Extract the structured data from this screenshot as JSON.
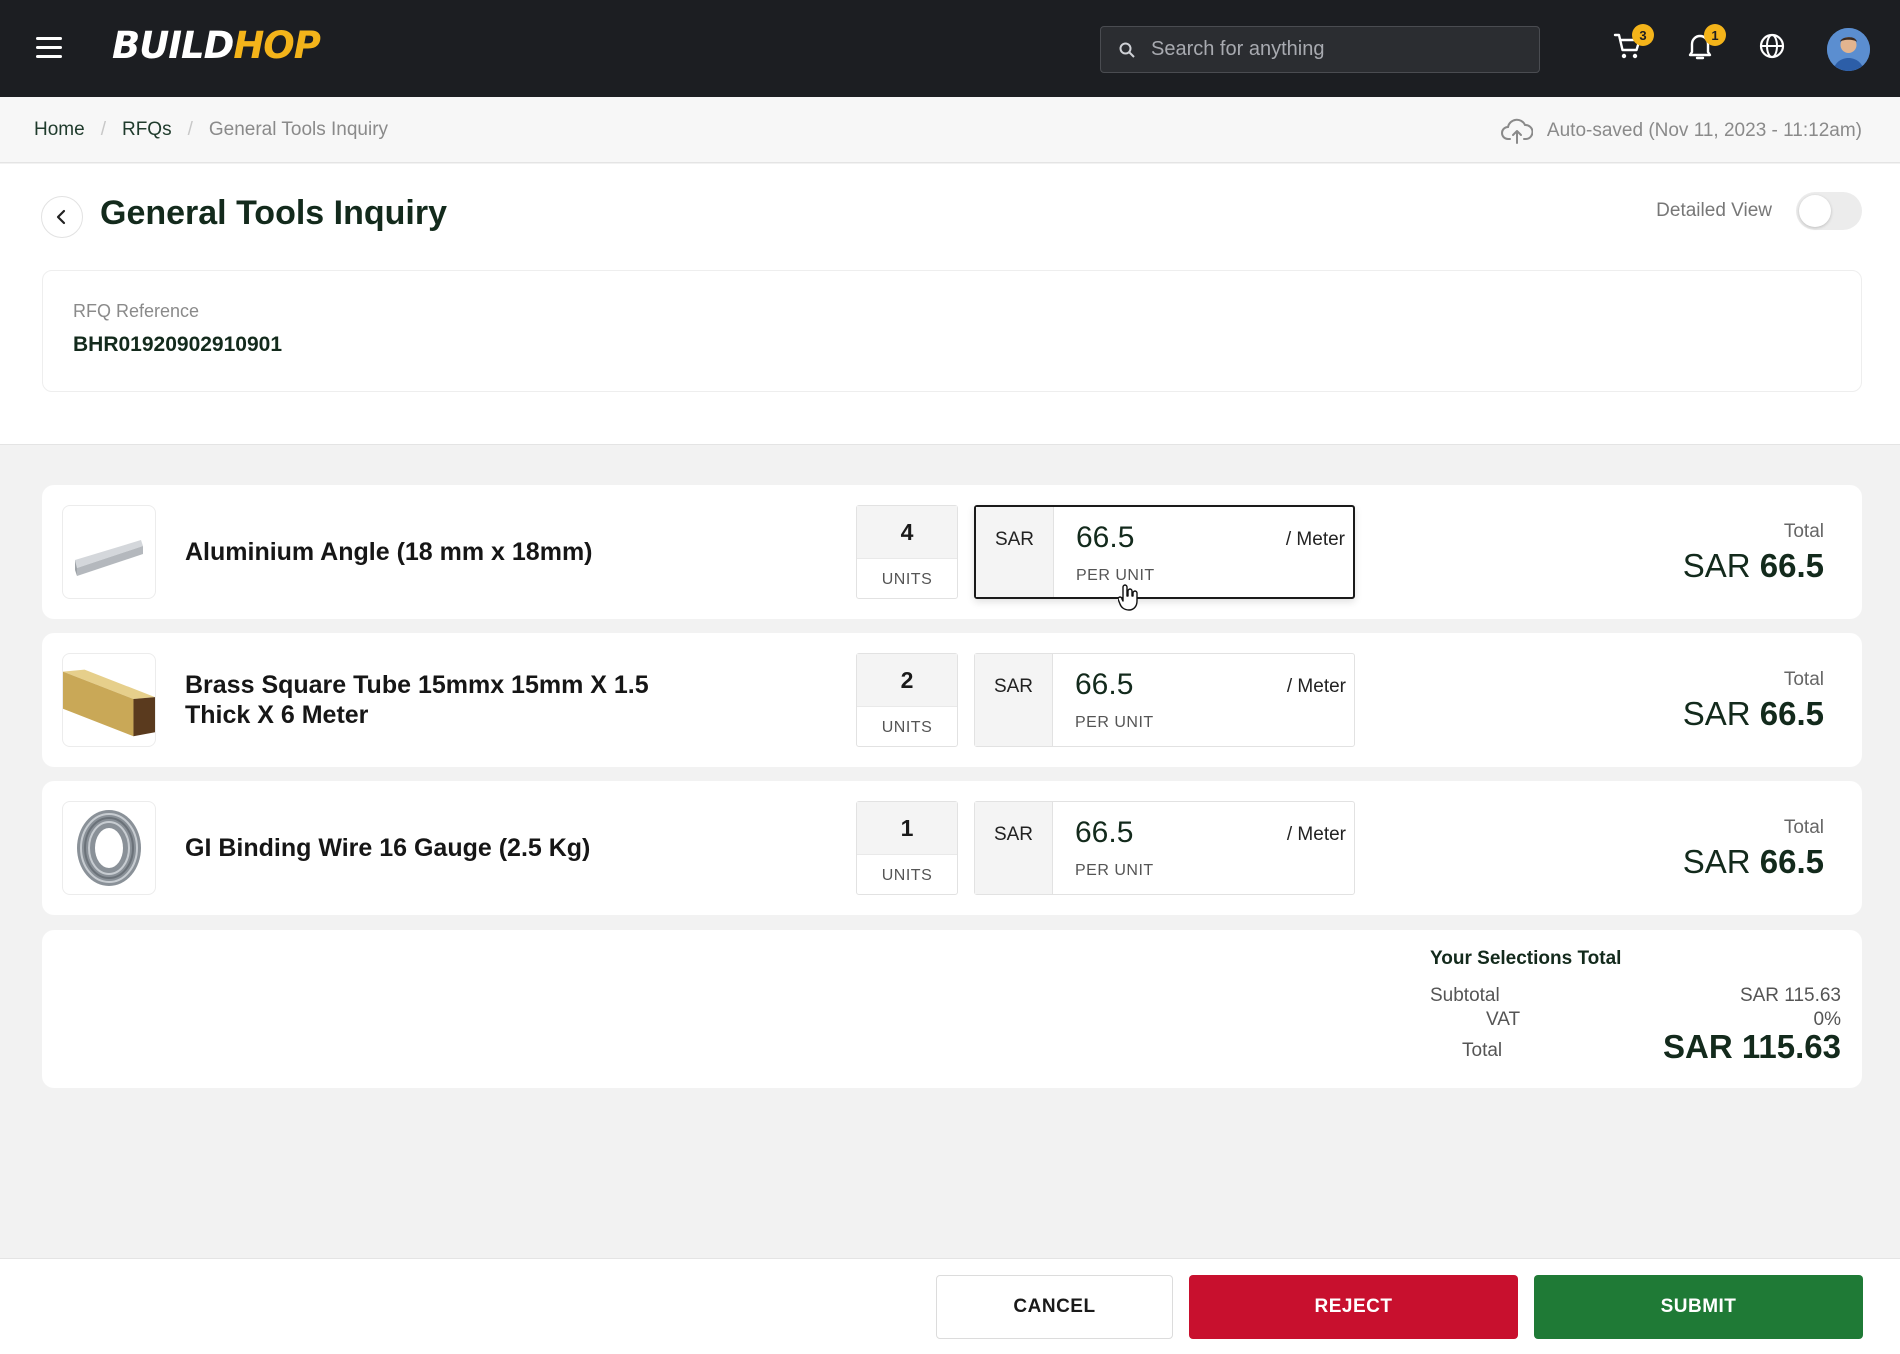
{
  "app": {
    "logo_main": "BUILD",
    "logo_accent": "HOP"
  },
  "topbar": {
    "search_placeholder": "Search for anything",
    "cart_count": "3",
    "notification_count": "1"
  },
  "breadcrumb": {
    "items": [
      "Home",
      "RFQs",
      "General Tools Inquiry"
    ]
  },
  "autosave": {
    "text": "Auto-saved (Nov 11, 2023 - 11:12am)"
  },
  "page": {
    "title": "General Tools Inquiry",
    "detailed_view_label": "Detailed View",
    "detailed_view_on": false
  },
  "rfq": {
    "reference_label": "RFQ Reference",
    "reference_value": "BHR01920902910901"
  },
  "items": [
    {
      "name": "Aluminium Angle (18 mm x 18mm)",
      "qty": "4",
      "qty_unit": "UNITS",
      "currency": "SAR",
      "price": "66.5",
      "per_unit": "PER UNIT",
      "uom": "/ Meter",
      "total_label": "Total",
      "total_currency": "SAR",
      "total_value": "66.5"
    },
    {
      "name": "Brass Square Tube 15mmx 15mm X 1.5 Thick X 6 Meter",
      "qty": "2",
      "qty_unit": "UNITS",
      "currency": "SAR",
      "price": "66.5",
      "per_unit": "PER UNIT",
      "uom": "/ Meter",
      "total_label": "Total",
      "total_currency": "SAR",
      "total_value": "66.5"
    },
    {
      "name": "GI Binding Wire 16 Gauge (2.5 Kg)",
      "qty": "1",
      "qty_unit": "UNITS",
      "currency": "SAR",
      "price": "66.5",
      "per_unit": "PER UNIT",
      "uom": "/ Meter",
      "total_label": "Total",
      "total_currency": "SAR",
      "total_value": "66.5"
    }
  ],
  "summary": {
    "title": "Your Selections Total",
    "subtotal_label": "Subtotal",
    "subtotal_value": "SAR 115.63",
    "vat_label": "VAT",
    "vat_value": "0%",
    "total_label": "Total",
    "total_value": "SAR 115.63"
  },
  "actions": {
    "cancel": "CANCEL",
    "reject": "REJECT",
    "submit": "SUBMIT"
  },
  "colors": {
    "topbar_bg": "#1c1e22",
    "brand_accent": "#f4b41a",
    "reject": "#c8102e",
    "submit": "#1f7a36",
    "title_text": "#132a1c"
  }
}
